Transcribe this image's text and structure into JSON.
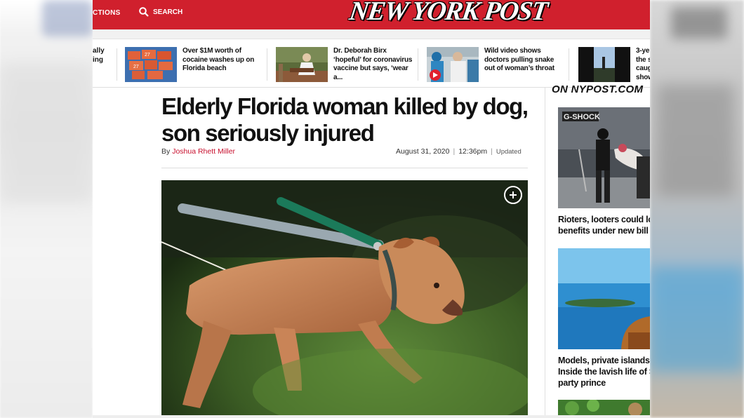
{
  "header": {
    "sections_label": "CTIONS",
    "search_label": "SEARCH",
    "logo_text": "NEW YORK POST"
  },
  "trending": {
    "partial_first": "ally\ning",
    "items": [
      {
        "caption": "Over $1M worth of cocaine washes up on Florida beach",
        "icon": "cocaine-bricks-thumb"
      },
      {
        "caption": "Dr. Deborah Birx ‘hopeful’ for coronavirus vaccine but says, ‘wear a...",
        "icon": "birx-podium-thumb"
      },
      {
        "caption": "Wild video shows doctors pulling snake out of woman’s throat",
        "icon": "doctors-video-thumb",
        "has_video": true
      },
      {
        "caption": "3-ye\nthe s\ncaug\nshow",
        "icon": "boy-field-thumb"
      }
    ]
  },
  "article": {
    "headline": "Elderly Florida woman killed by dog, son seriously injured",
    "by_prefix": "By",
    "author": "Joshua Rhett Miller",
    "date": "August 31, 2020",
    "time": "12:36pm",
    "updated_label": "Updated"
  },
  "sidebar": {
    "heading": "ON NYPOST.COM",
    "stories": [
      {
        "caption_line1": "Rioters, looters could lo",
        "caption_line2": "benefits under new bill"
      },
      {
        "caption_line1": "Models, private islands",
        "caption_line2": "Inside the lavish life of S",
        "caption_line3": "party prince"
      }
    ]
  },
  "colors": {
    "brand_red": "#d0202d",
    "author_red": "#c8102e"
  }
}
